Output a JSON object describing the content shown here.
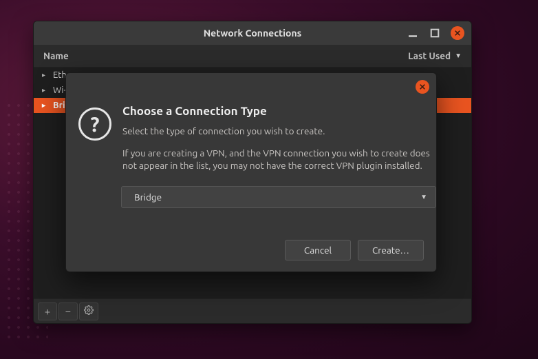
{
  "window": {
    "title": "Network Connections",
    "columns": {
      "name": "Name",
      "last_used": "Last Used"
    },
    "rows": [
      {
        "label": "Eth",
        "selected": false
      },
      {
        "label": "Wi-",
        "selected": false
      },
      {
        "label": "Bri",
        "selected": true
      }
    ],
    "toolbar": {
      "add": "+",
      "remove": "−",
      "settings": "⚙"
    }
  },
  "dialog": {
    "title": "Choose a Connection Type",
    "subtitle": "Select the type of connection you wish to create.",
    "note": "If you are creating a VPN, and the VPN connection you wish to create does not appear in the list, you may not have the correct VPN plugin installed.",
    "combo_value": "Bridge",
    "cancel": "Cancel",
    "create": "Create…",
    "question_mark": "?"
  }
}
